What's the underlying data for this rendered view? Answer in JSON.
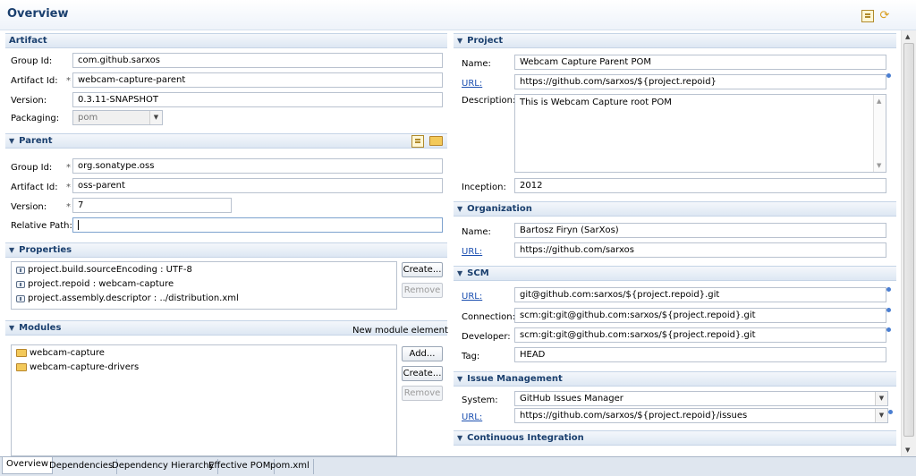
{
  "header": {
    "title": "Overview"
  },
  "artifact": {
    "title": "Artifact",
    "group_id_label": "Group Id:",
    "group_id": "com.github.sarxos",
    "artifact_id_label": "Artifact Id:",
    "artifact_id": "webcam-capture-parent",
    "version_label": "Version:",
    "version": "0.3.11-SNAPSHOT",
    "packaging_label": "Packaging:",
    "packaging": "pom"
  },
  "parent": {
    "title": "Parent",
    "group_id_label": "Group Id:",
    "group_id": "org.sonatype.oss",
    "artifact_id_label": "Artifact Id:",
    "artifact_id": "oss-parent",
    "version_label": "Version:",
    "version": "7",
    "relative_path_label": "Relative Path:",
    "relative_path": ""
  },
  "properties": {
    "title": "Properties",
    "items": [
      "project.build.sourceEncoding : UTF-8",
      "project.repoid : webcam-capture",
      "project.assembly.descriptor : ../distribution.xml"
    ],
    "create_label": "Create...",
    "remove_label": "Remove"
  },
  "modules": {
    "title": "Modules",
    "new_module_label": "New module element",
    "items": [
      "webcam-capture",
      "webcam-capture-drivers"
    ],
    "add_label": "Add...",
    "create_label": "Create...",
    "remove_label": "Remove"
  },
  "project": {
    "title": "Project",
    "name_label": "Name:",
    "name": "Webcam Capture Parent POM",
    "url_label": "URL:",
    "url": "https://github.com/sarxos/${project.repoid}",
    "description_label": "Description:",
    "description": "This is Webcam Capture root POM",
    "inception_label": "Inception:",
    "inception": "2012"
  },
  "organization": {
    "title": "Organization",
    "name_label": "Name:",
    "name": "Bartosz Firyn (SarXos)",
    "url_label": "URL:",
    "url": "https://github.com/sarxos"
  },
  "scm": {
    "title": "SCM",
    "url_label": "URL:",
    "url": "git@github.com:sarxos/${project.repoid}.git",
    "connection_label": "Connection:",
    "connection": "scm:git:git@github.com:sarxos/${project.repoid}.git",
    "developer_label": "Developer:",
    "developer": "scm:git:git@github.com:sarxos/${project.repoid}.git",
    "tag_label": "Tag:",
    "tag": "HEAD"
  },
  "issue_management": {
    "title": "Issue Management",
    "system_label": "System:",
    "system": "GitHub Issues Manager",
    "url_label": "URL:",
    "url": "https://github.com/sarxos/${project.repoid}/issues"
  },
  "ci": {
    "title": "Continuous Integration"
  },
  "tabs": [
    "Overview",
    "Dependencies",
    "Dependency Hierarchy",
    "Effective POM",
    "pom.xml"
  ],
  "colors": {
    "section_title": "#1a3f6e",
    "link": "#1b4fb0",
    "header_gradient_end": "#dde7f3"
  }
}
